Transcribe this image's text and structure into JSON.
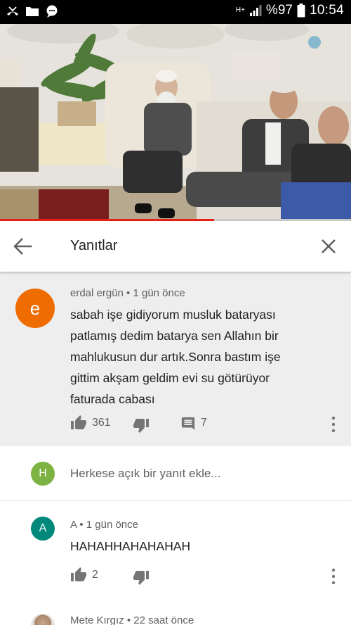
{
  "status_bar": {
    "network": "H+",
    "battery": "%97",
    "time": "10:54"
  },
  "video": {
    "progress_fraction": 0.61
  },
  "header": {
    "title": "Yanıtlar"
  },
  "main_comment": {
    "avatar_letter": "e",
    "avatar_color": "#ef6c00",
    "author": "erdal ergün",
    "time": "1 gün önce",
    "meta": "erdal ergün • 1 gün önce",
    "lines": [
      "sabah işe gidiyorum musluk bataryası",
      "patlamış dedim batarya sen Allahın bir",
      "mahlukusun dur artık.Sonra bastım işe",
      "gittim akşam geldim evi su götürüyor",
      "faturada cabası"
    ],
    "likes": "361",
    "replies": "7"
  },
  "reply_input": {
    "avatar_letter": "H",
    "avatar_color": "#7cb342",
    "placeholder": "Herkese açık bir yanıt ekle..."
  },
  "reply": {
    "avatar_letter": "A",
    "avatar_color": "#00897b",
    "meta": "A • 1 gün önce",
    "text": "HAHAHHAHAHAHAH",
    "likes": "2"
  },
  "next_reply": {
    "meta": "Mete Kırgız • 22 saat önce"
  }
}
